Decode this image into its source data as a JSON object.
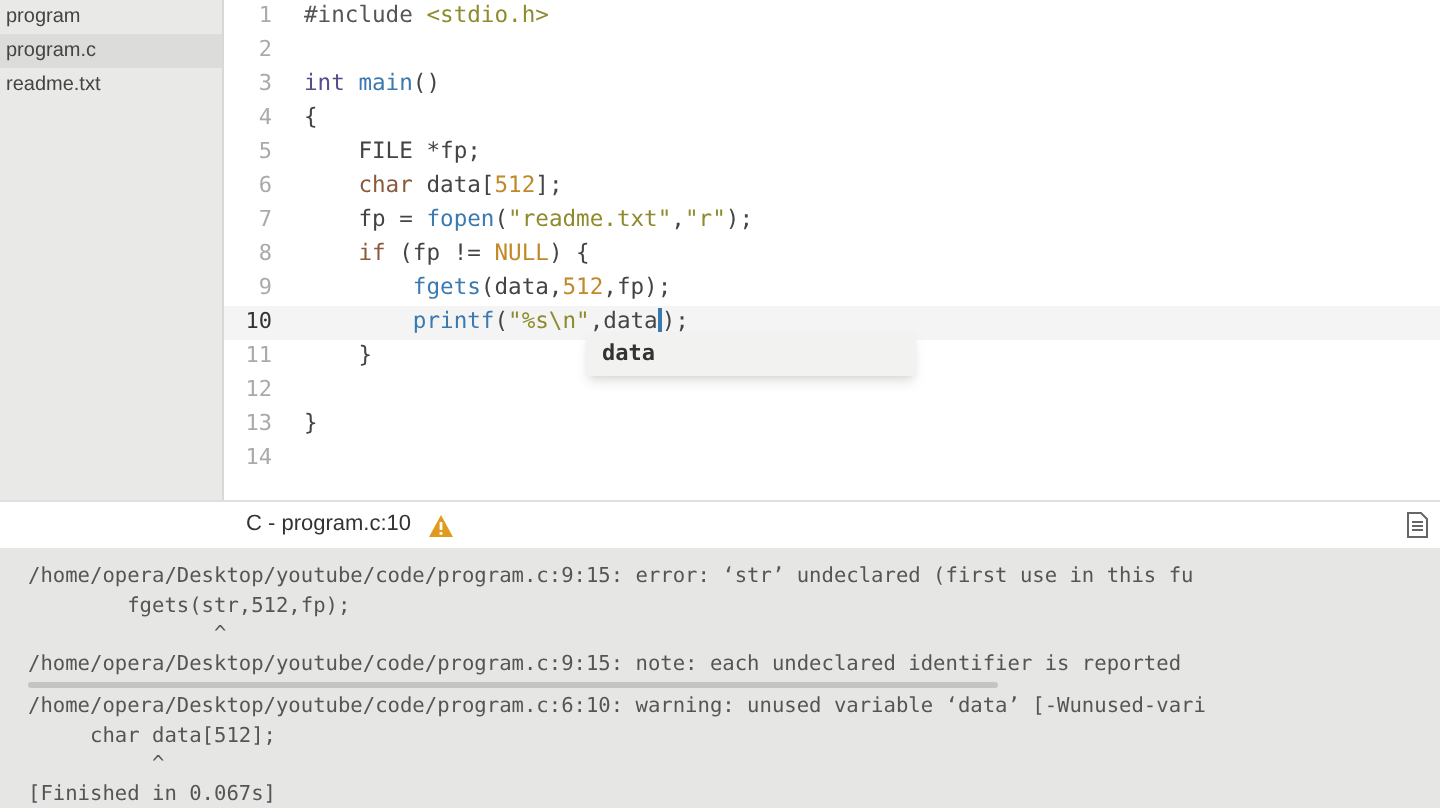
{
  "sidebar": {
    "items": [
      {
        "label": "program",
        "selected": false
      },
      {
        "label": "program.c",
        "selected": true
      },
      {
        "label": "readme.txt",
        "selected": false
      }
    ]
  },
  "editor": {
    "lines": [
      {
        "number": "1",
        "current": false,
        "tokens": [
          {
            "kind": "preproc",
            "text": "#include "
          },
          {
            "kind": "string",
            "text": "<stdio.h>"
          }
        ]
      },
      {
        "number": "2",
        "current": false
      },
      {
        "number": "3",
        "current": false,
        "tokens": [
          {
            "kind": "type",
            "text": "int"
          },
          {
            "kind": "function",
            "text": " main"
          },
          {
            "kind": "plain",
            "text": "()"
          }
        ]
      },
      {
        "number": "4",
        "current": false,
        "tokens": [
          {
            "kind": "plain",
            "text": "{"
          }
        ]
      },
      {
        "number": "5",
        "current": false,
        "tokens": [
          {
            "kind": "plain",
            "text": "    FILE *fp;"
          }
        ]
      },
      {
        "number": "6",
        "current": false,
        "tokens": [
          {
            "kind": "keyword",
            "text": "    char"
          },
          {
            "kind": "plain",
            "text": " data["
          },
          {
            "kind": "number",
            "text": "512"
          },
          {
            "kind": "plain",
            "text": "];"
          }
        ]
      },
      {
        "number": "7",
        "current": false,
        "tokens": [
          {
            "kind": "plain",
            "text": "    fp = "
          },
          {
            "kind": "function",
            "text": "fopen"
          },
          {
            "kind": "plain",
            "text": "("
          },
          {
            "kind": "string",
            "text": "\"readme.txt\""
          },
          {
            "kind": "plain",
            "text": ","
          },
          {
            "kind": "string",
            "text": "\"r\""
          },
          {
            "kind": "plain",
            "text": ");"
          }
        ]
      },
      {
        "number": "8",
        "current": false,
        "tokens": [
          {
            "kind": "keyword",
            "text": "    if"
          },
          {
            "kind": "plain",
            "text": " (fp != "
          },
          {
            "kind": "number",
            "text": "NULL"
          },
          {
            "kind": "plain",
            "text": ") {"
          }
        ]
      },
      {
        "number": "9",
        "current": false,
        "tokens": [
          {
            "kind": "function",
            "text": "        fgets"
          },
          {
            "kind": "plain",
            "text": "(data,"
          },
          {
            "kind": "number",
            "text": "512"
          },
          {
            "kind": "plain",
            "text": ",fp);"
          }
        ]
      },
      {
        "number": "10",
        "current": true,
        "tokens": [
          {
            "kind": "function",
            "text": "        printf"
          },
          {
            "kind": "plain",
            "text": "("
          },
          {
            "kind": "string",
            "text": "\"%s\\n\""
          },
          {
            "kind": "plain",
            "text": ",data"
          },
          {
            "kind": "cursor",
            "text": ")"
          },
          {
            "kind": "plain",
            "text": ";"
          }
        ]
      },
      {
        "number": "11",
        "current": false,
        "tokens": [
          {
            "kind": "plain",
            "text": "    }"
          }
        ]
      },
      {
        "number": "12",
        "current": false
      },
      {
        "number": "13",
        "current": false,
        "tokens": [
          {
            "kind": "plain",
            "text": "}"
          }
        ]
      },
      {
        "number": "14",
        "current": false
      }
    ],
    "autocomplete": {
      "items": [
        "data"
      ]
    }
  },
  "status_bar": {
    "text": "C - program.c:10"
  },
  "output": {
    "lines": [
      "/home/opera/Desktop/youtube/code/program.c:9:15: error: ‘str’ undeclared (first use in this fu",
      "        fgets(str,512,fp);",
      "               ^",
      "/home/opera/Desktop/youtube/code/program.c:9:15: note: each undeclared identifier is reported",
      "/home/opera/Desktop/youtube/code/program.c:6:10: warning: unused variable ‘data’ [-Wunused-vari",
      "     char data[512];",
      "          ^",
      "[Finished in 0.067s]"
    ]
  }
}
